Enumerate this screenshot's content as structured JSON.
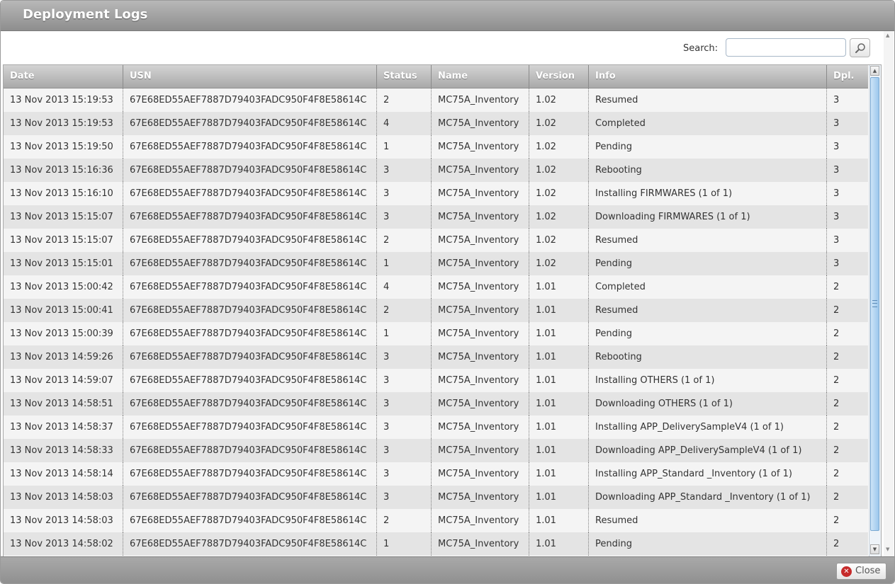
{
  "window": {
    "title": "Deployment Logs"
  },
  "search": {
    "label": "Search:",
    "value": "",
    "placeholder": "",
    "button_icon": "magnifier-icon"
  },
  "columns": [
    "Date",
    "USN",
    "Status",
    "Name",
    "Version",
    "Info",
    "Dpl."
  ],
  "rows": [
    [
      "13 Nov 2013 15:19:53",
      "67E68ED55AEF7887D79403FADC950F4F8E58614C",
      "2",
      "MC75A_Inventory",
      "1.02",
      "Resumed",
      "3"
    ],
    [
      "13 Nov 2013 15:19:53",
      "67E68ED55AEF7887D79403FADC950F4F8E58614C",
      "4",
      "MC75A_Inventory",
      "1.02",
      "Completed",
      "3"
    ],
    [
      "13 Nov 2013 15:19:50",
      "67E68ED55AEF7887D79403FADC950F4F8E58614C",
      "1",
      "MC75A_Inventory",
      "1.02",
      "Pending",
      "3"
    ],
    [
      "13 Nov 2013 15:16:36",
      "67E68ED55AEF7887D79403FADC950F4F8E58614C",
      "3",
      "MC75A_Inventory",
      "1.02",
      "Rebooting",
      "3"
    ],
    [
      "13 Nov 2013 15:16:10",
      "67E68ED55AEF7887D79403FADC950F4F8E58614C",
      "3",
      "MC75A_Inventory",
      "1.02",
      "Installing FIRMWARES (1 of 1)",
      "3"
    ],
    [
      "13 Nov 2013 15:15:07",
      "67E68ED55AEF7887D79403FADC950F4F8E58614C",
      "3",
      "MC75A_Inventory",
      "1.02",
      "Downloading FIRMWARES (1 of 1)",
      "3"
    ],
    [
      "13 Nov 2013 15:15:07",
      "67E68ED55AEF7887D79403FADC950F4F8E58614C",
      "2",
      "MC75A_Inventory",
      "1.02",
      "Resumed",
      "3"
    ],
    [
      "13 Nov 2013 15:15:01",
      "67E68ED55AEF7887D79403FADC950F4F8E58614C",
      "1",
      "MC75A_Inventory",
      "1.02",
      "Pending",
      "3"
    ],
    [
      "13 Nov 2013 15:00:42",
      "67E68ED55AEF7887D79403FADC950F4F8E58614C",
      "4",
      "MC75A_Inventory",
      "1.01",
      "Completed",
      "2"
    ],
    [
      "13 Nov 2013 15:00:41",
      "67E68ED55AEF7887D79403FADC950F4F8E58614C",
      "2",
      "MC75A_Inventory",
      "1.01",
      "Resumed",
      "2"
    ],
    [
      "13 Nov 2013 15:00:39",
      "67E68ED55AEF7887D79403FADC950F4F8E58614C",
      "1",
      "MC75A_Inventory",
      "1.01",
      "Pending",
      "2"
    ],
    [
      "13 Nov 2013 14:59:26",
      "67E68ED55AEF7887D79403FADC950F4F8E58614C",
      "3",
      "MC75A_Inventory",
      "1.01",
      "Rebooting",
      "2"
    ],
    [
      "13 Nov 2013 14:59:07",
      "67E68ED55AEF7887D79403FADC950F4F8E58614C",
      "3",
      "MC75A_Inventory",
      "1.01",
      "Installing OTHERS (1 of 1)",
      "2"
    ],
    [
      "13 Nov 2013 14:58:51",
      "67E68ED55AEF7887D79403FADC950F4F8E58614C",
      "3",
      "MC75A_Inventory",
      "1.01",
      "Downloading OTHERS (1 of 1)",
      "2"
    ],
    [
      "13 Nov 2013 14:58:37",
      "67E68ED55AEF7887D79403FADC950F4F8E58614C",
      "3",
      "MC75A_Inventory",
      "1.01",
      "Installing APP_DeliverySampleV4 (1 of 1)",
      "2"
    ],
    [
      "13 Nov 2013 14:58:33",
      "67E68ED55AEF7887D79403FADC950F4F8E58614C",
      "3",
      "MC75A_Inventory",
      "1.01",
      "Downloading APP_DeliverySampleV4 (1 of 1)",
      "2"
    ],
    [
      "13 Nov 2013 14:58:14",
      "67E68ED55AEF7887D79403FADC950F4F8E58614C",
      "3",
      "MC75A_Inventory",
      "1.01",
      "Installing APP_Standard _Inventory (1 of 1)",
      "2"
    ],
    [
      "13 Nov 2013 14:58:03",
      "67E68ED55AEF7887D79403FADC950F4F8E58614C",
      "3",
      "MC75A_Inventory",
      "1.01",
      "Downloading APP_Standard _Inventory (1 of 1)",
      "2"
    ],
    [
      "13 Nov 2013 14:58:03",
      "67E68ED55AEF7887D79403FADC950F4F8E58614C",
      "2",
      "MC75A_Inventory",
      "1.01",
      "Resumed",
      "2"
    ],
    [
      "13 Nov 2013 14:58:02",
      "67E68ED55AEF7887D79403FADC950F4F8E58614C",
      "1",
      "MC75A_Inventory",
      "1.01",
      "Pending",
      "2"
    ]
  ],
  "footer": {
    "close_label": "Close",
    "close_icon": "close-icon"
  },
  "colors": {
    "title_bar": "#9e9e9e",
    "header": "#bdbdbd",
    "row_odd": "#f4f4f4",
    "row_even": "#e4e4e4",
    "close_icon": "#c62a2a",
    "scroll_thumb": "#9cc7ec"
  }
}
